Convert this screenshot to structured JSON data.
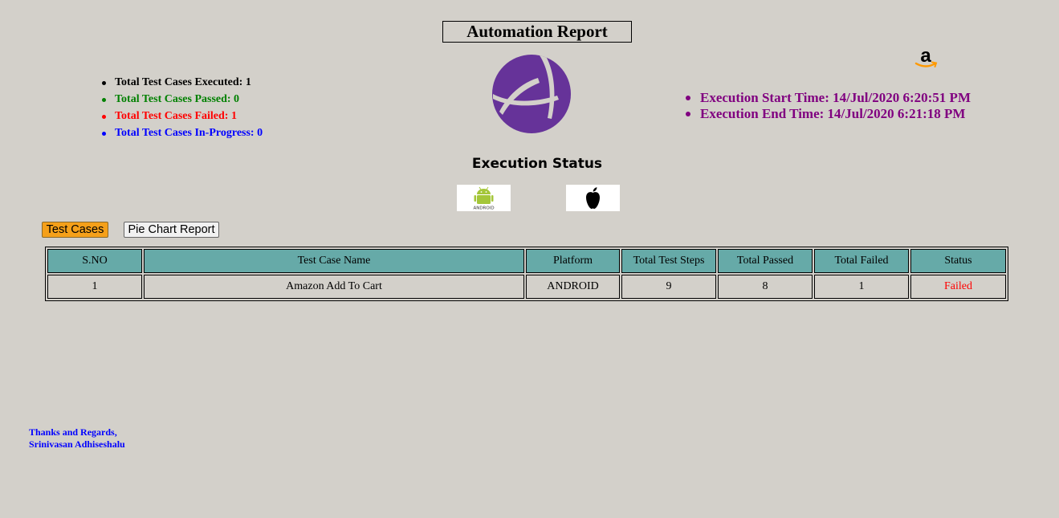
{
  "header": {
    "title": "Automation Report"
  },
  "summary": {
    "executed": "Total Test Cases Executed: 1",
    "passed": "Total Test Cases Passed: 0",
    "failed": "Total Test Cases Failed: 1",
    "in_progress": "Total Test Cases In-Progress: 0",
    "colors": {
      "executed": "#000000",
      "passed": "#008000",
      "failed": "#ff0000",
      "in_progress": "#0000ff"
    }
  },
  "execution_times": {
    "start": "Execution Start Time: 14/Jul/2020 6:20:51 PM",
    "end": "Execution End Time: 14/Jul/2020 6:21:18 PM"
  },
  "status_section": {
    "title": "Execution Status",
    "platforms": [
      {
        "icon": "android-icon",
        "label": "ANDROID"
      },
      {
        "icon": "apple-icon"
      }
    ]
  },
  "tabs": {
    "test_cases": "Test Cases",
    "pie_chart": "Pie Chart Report"
  },
  "table": {
    "headers": [
      "S.NO",
      "Test Case Name",
      "Platform",
      "Total Test Steps",
      "Total Passed",
      "Total Failed",
      "Status"
    ],
    "rows": [
      [
        "1",
        "Amazon Add To Cart",
        "ANDROID",
        "9",
        "8",
        "1",
        "Failed"
      ]
    ]
  },
  "footer": {
    "line1": "Thanks and Regards,",
    "line2": "Srinivasan Adhiseshalu"
  },
  "colors": {
    "background": "#d3d0ca",
    "header_bg": "#66aaa8",
    "tab_active": "#f5a01a",
    "failed": "#ff0000",
    "time_color": "#800080",
    "logo_purple": "#663399"
  }
}
